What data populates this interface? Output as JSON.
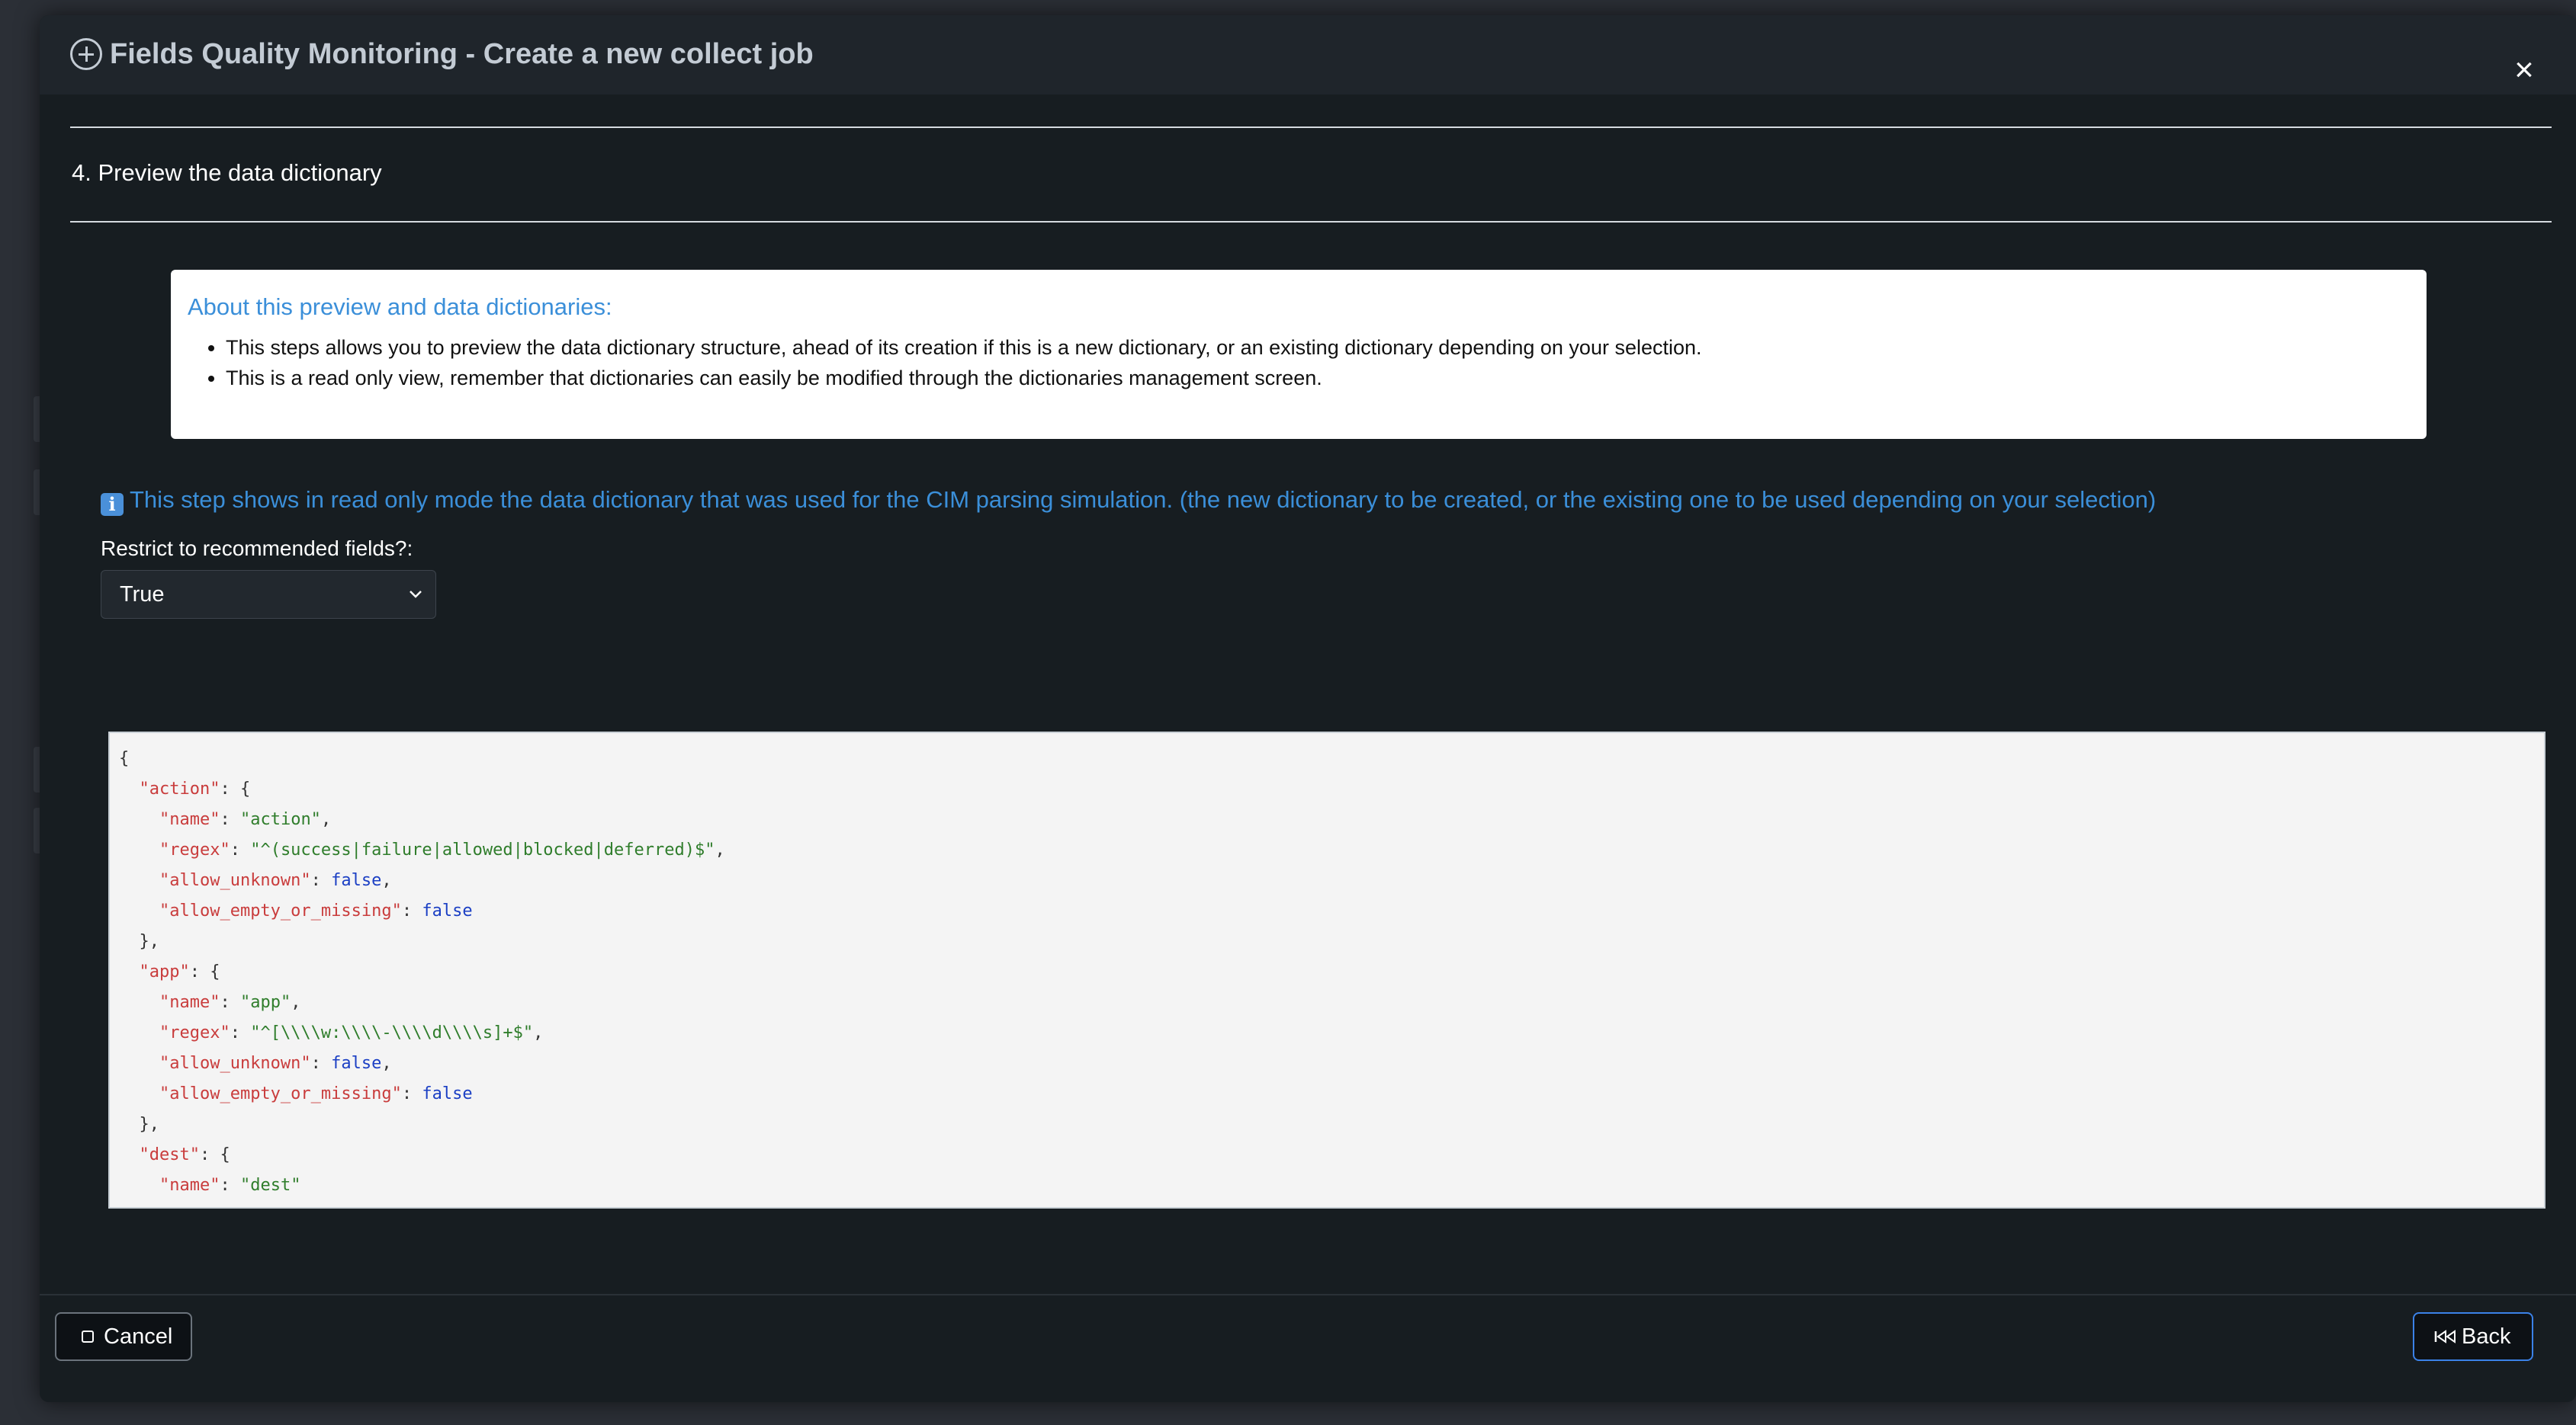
{
  "modal": {
    "title": "Fields Quality Monitoring - Create a new collect job",
    "close_label": "×"
  },
  "step": {
    "title": "4. Preview the data dictionary"
  },
  "info_box": {
    "title": "About this preview and data dictionaries:",
    "items": [
      "This steps allows you to preview the data dictionary structure, ahead of its creation if this is a new dictionary, or an existing dictionary depending on your selection.",
      "This is a read only view, remember that dictionaries can easily be modified through the dictionaries management screen."
    ]
  },
  "hint": {
    "icon": "info-icon",
    "text": "This step shows in read only mode the data dictionary that was used for the CIM parsing simulation. (the new dictionary to be created, or the existing one to be used depending on your selection)"
  },
  "restrict": {
    "label": "Restrict to recommended fields?:",
    "selected": "True"
  },
  "dictionary_preview": {
    "action": {
      "name": "action",
      "regex": "^(success|failure|allowed|blocked|deferred)$",
      "allow_unknown": false,
      "allow_empty_or_missing": false
    },
    "app": {
      "name": "app",
      "regex": "^[\\\\w:\\\\-\\\\d\\\\s]+$",
      "allow_unknown": false,
      "allow_empty_or_missing": false
    },
    "dest": {
      "name": "dest"
    }
  },
  "footer": {
    "cancel_label": "Cancel",
    "back_label": "Back"
  },
  "colors": {
    "modal_bg": "#171d21",
    "accent_blue": "#3b8fd9",
    "json_key": "#c93c3c",
    "json_string": "#2f7d2b",
    "json_bool": "#1b3fc4"
  }
}
